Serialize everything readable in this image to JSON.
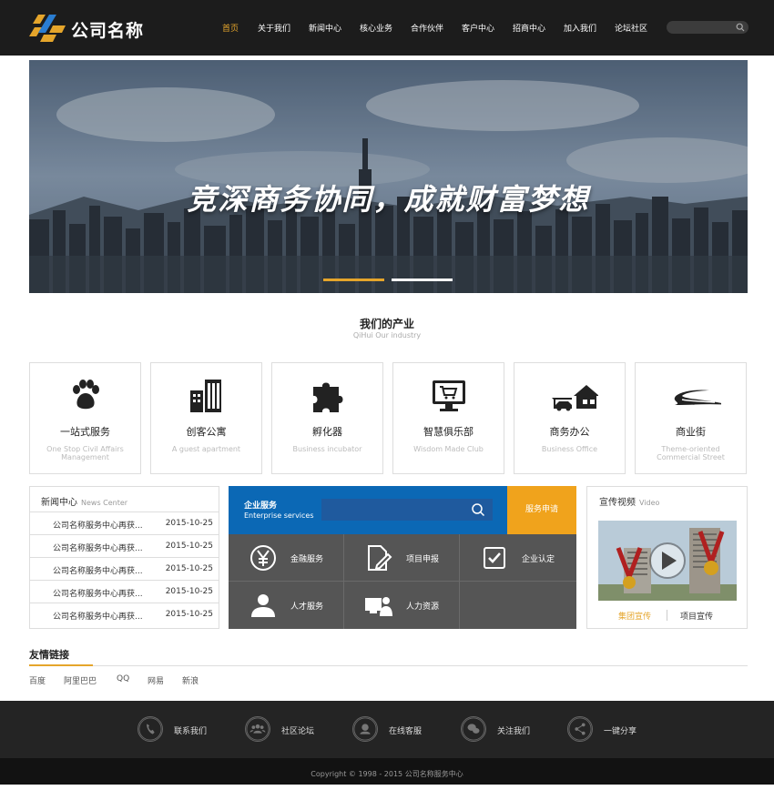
{
  "header": {
    "logo_text": "公司名称",
    "nav": [
      "首页",
      "关于我们",
      "新闻中心",
      "核心业务",
      "合作伙伴",
      "客户中心",
      "招商中心",
      "加入我们",
      "论坛社区"
    ],
    "active_nav": "首页",
    "accent_color": "#e5a52b"
  },
  "banner": {
    "title": "竞深商务协同，成就财富梦想",
    "active_dot": 1
  },
  "industry": {
    "title": "我们的产业",
    "subtitle": "QiHui Our industry",
    "items": [
      {
        "name": "一站式服务",
        "en": "One Stop Civil Affairs Management",
        "icon": "paw-icon"
      },
      {
        "name": "创客公寓",
        "en": "A guest apartment",
        "icon": "buildings-icon"
      },
      {
        "name": "孵化器",
        "en": "Business incubator",
        "icon": "puzzle-icon"
      },
      {
        "name": "智慧俱乐部",
        "en": "Wisdom Made Club",
        "icon": "monitor-cart-icon"
      },
      {
        "name": "商务办公",
        "en": "Business Office",
        "icon": "house-car-icon"
      },
      {
        "name": "商业街",
        "en": "Theme-oriented Commercial Street",
        "icon": "road-icon"
      }
    ]
  },
  "news": {
    "title": "新闻中心",
    "title_en": "News Center",
    "items": [
      {
        "title": "公司名称服务中心再获...",
        "date": "2015-10-25"
      },
      {
        "title": "公司名称服务中心再获...",
        "date": "2015-10-25"
      },
      {
        "title": "公司名称服务中心再获...",
        "date": "2015-10-25"
      },
      {
        "title": "公司名称服务中心再获...",
        "date": "2015-10-25"
      },
      {
        "title": "公司名称服务中心再获...",
        "date": "2015-10-25"
      }
    ]
  },
  "services": {
    "title": "企业服务",
    "title_en": "Enterprise services",
    "apply_label": "服务申请",
    "top_color": "#0b68b5",
    "apply_color": "#f0a31c",
    "cells": [
      {
        "label": "金融服务",
        "icon": "yen-icon"
      },
      {
        "label": "项目申报",
        "icon": "edit-document-icon"
      },
      {
        "label": "企业认定",
        "icon": "check-box-icon"
      },
      {
        "label": "人才服务",
        "icon": "person-icon"
      },
      {
        "label": "人力资源",
        "icon": "person-screen-icon"
      }
    ]
  },
  "video": {
    "title": "宣传视频",
    "title_en": "Video",
    "tabs": [
      "集团宣传",
      "项目宣传"
    ],
    "active_tab": "集团宣传"
  },
  "links": {
    "title": "友情链接",
    "items": [
      "百度",
      "阿里巴巴",
      "QQ",
      "网易",
      "新浪"
    ]
  },
  "footer": {
    "items": [
      {
        "label": "联系我们",
        "icon": "phone-icon"
      },
      {
        "label": "社区论坛",
        "icon": "group-icon"
      },
      {
        "label": "在线客服",
        "icon": "headset-icon"
      },
      {
        "label": "关注我们",
        "icon": "wechat-icon"
      },
      {
        "label": "一键分享",
        "icon": "share-icon"
      }
    ],
    "copyright": "Copyright © 1998 - 2015 公司名称服务中心"
  }
}
